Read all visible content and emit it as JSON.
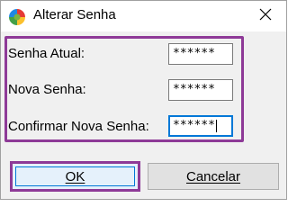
{
  "window": {
    "title": "Alterar Senha",
    "close_icon": "close-icon",
    "app_icon": "colorful-app-icon"
  },
  "form": {
    "current_password_label": "Senha Atual:",
    "current_password_value": "******",
    "new_password_label": "Nova Senha:",
    "new_password_value": "******",
    "confirm_password_label": "Confirmar Nova Senha:",
    "confirm_password_value": "******"
  },
  "buttons": {
    "ok_label": "OK",
    "cancel_label": "Cancelar"
  },
  "colors": {
    "highlight_border": "#8e3a97",
    "focus_border": "#0078d7"
  }
}
